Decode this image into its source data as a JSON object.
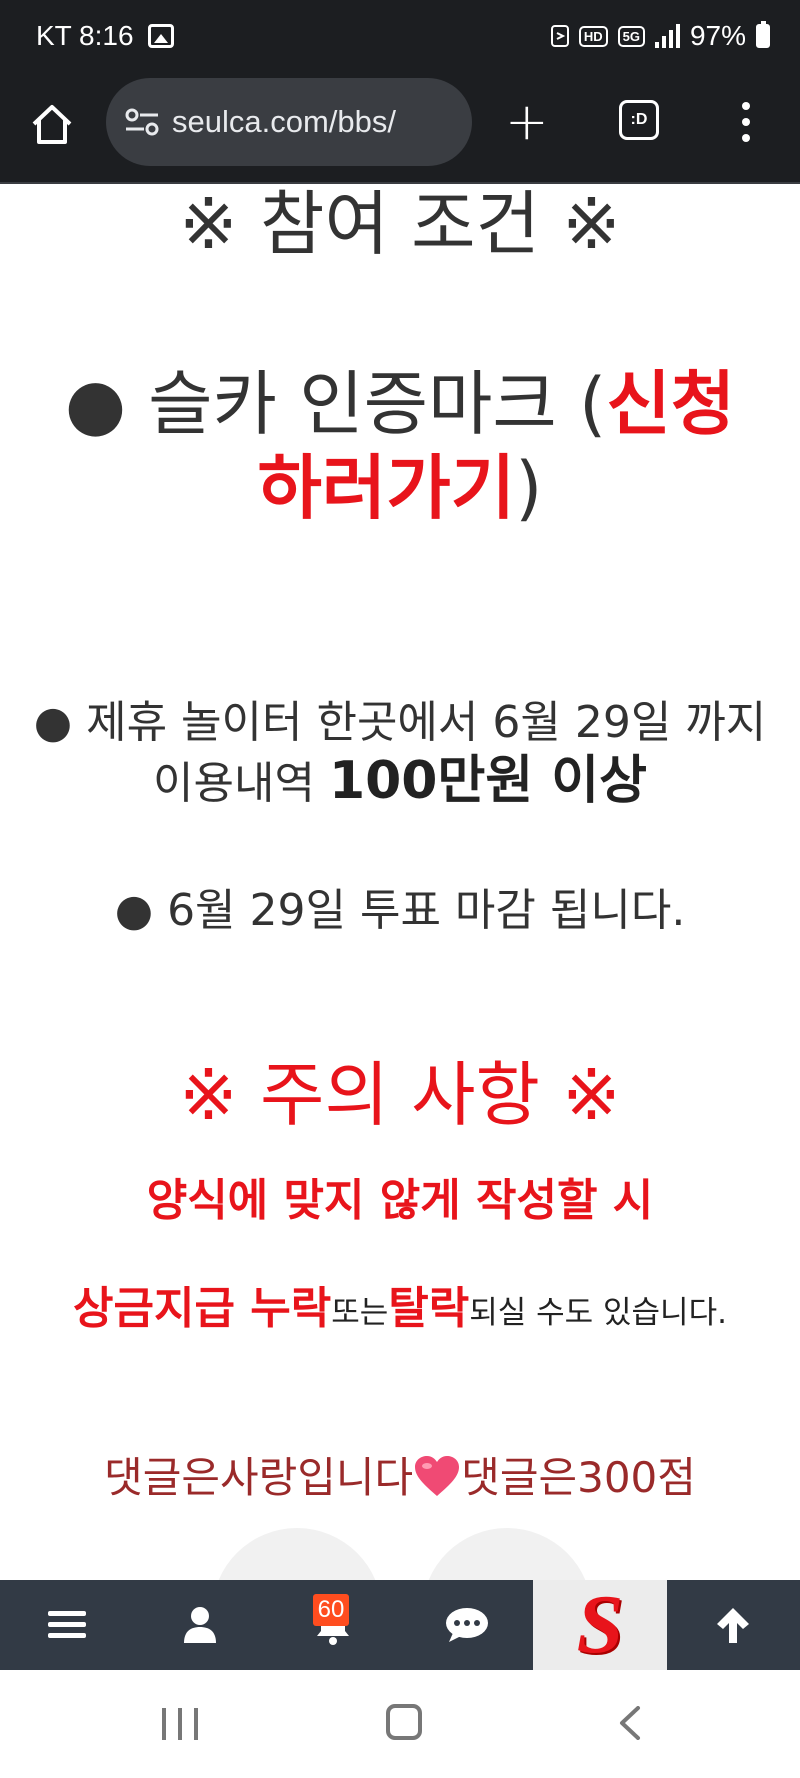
{
  "status_bar": {
    "carrier_time": "KT 8:16",
    "hd_badge": "HD",
    "network_badge": "5G",
    "battery": "97%"
  },
  "browser": {
    "url": "seulca.com/bbs/",
    "tabs_label": ":D"
  },
  "post": {
    "conditions_heading": "※ 참여 조건 ※",
    "brand_prefix": "● 슬카 인증마크 (",
    "brand_link": "신청하러가기",
    "brand_suffix": ")",
    "usage_prefix": "● 제휴 놀이터 한곳에서 6월 29일 까지 이용내역 ",
    "usage_bold": "100만원 이상",
    "deadline": "● 6월 29일 투표 마감 됩니다.",
    "caution_heading": "※ 주의 사항 ※",
    "caution_line": "양식에 맞지 않게 작성할 시",
    "penalty_red1": "상금지급 누락",
    "penalty_mid": "또는",
    "penalty_red2": "탈락",
    "penalty_tail": "되실 수도 있습니다.",
    "comment_left": "댓글은사랑입니다",
    "comment_right": "댓글은300점"
  },
  "bottom_nav": {
    "items": [
      {
        "icon": "hamburger-menu-icon"
      },
      {
        "icon": "user-icon"
      },
      {
        "icon": "bell-icon",
        "badge": "60"
      },
      {
        "icon": "chat-icon"
      },
      {
        "icon": "site-logo",
        "logo_letter": "S"
      },
      {
        "icon": "arrow-up-icon"
      }
    ]
  },
  "colors": {
    "accent_red": "#e8141b",
    "dark_bar": "#1c1e21",
    "nav_bar": "#323a45",
    "badge": "#ff4d1f",
    "comment_text": "#9a2a2a"
  }
}
